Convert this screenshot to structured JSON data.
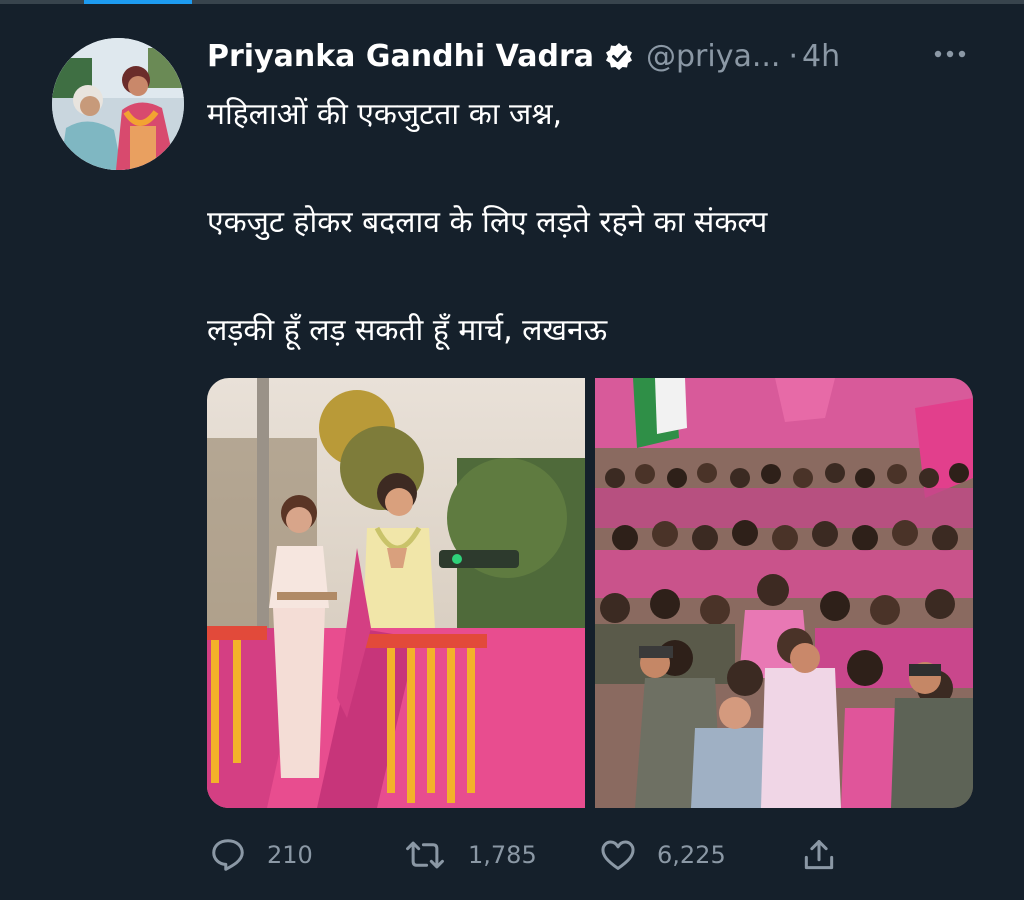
{
  "tweet": {
    "author_name": "Priyanka Gandhi Vadra",
    "handle": "@priya...",
    "separator": "·",
    "time": "4h",
    "lines": [
      "महिलाओं की एकजुटता का जश्न,",
      "एकजुट होकर बदलाव के लिए लड़ते रहने का संकल्प",
      "लड़की हूँ लड़ सकती हूँ मार्च, लखनऊ"
    ],
    "stats": {
      "replies": "210",
      "retweets": "1,785",
      "likes": "6,225"
    }
  },
  "icons": {
    "verified": "verified-badge-icon",
    "more": "more-options-icon",
    "reply": "reply-icon",
    "retweet": "retweet-icon",
    "like": "heart-icon",
    "share": "share-icon"
  },
  "colors": {
    "background": "#15202b",
    "text_primary": "#ffffff",
    "text_secondary": "#8b98a5",
    "accent": "#1d9bf0",
    "pink": "#e53a8f"
  }
}
